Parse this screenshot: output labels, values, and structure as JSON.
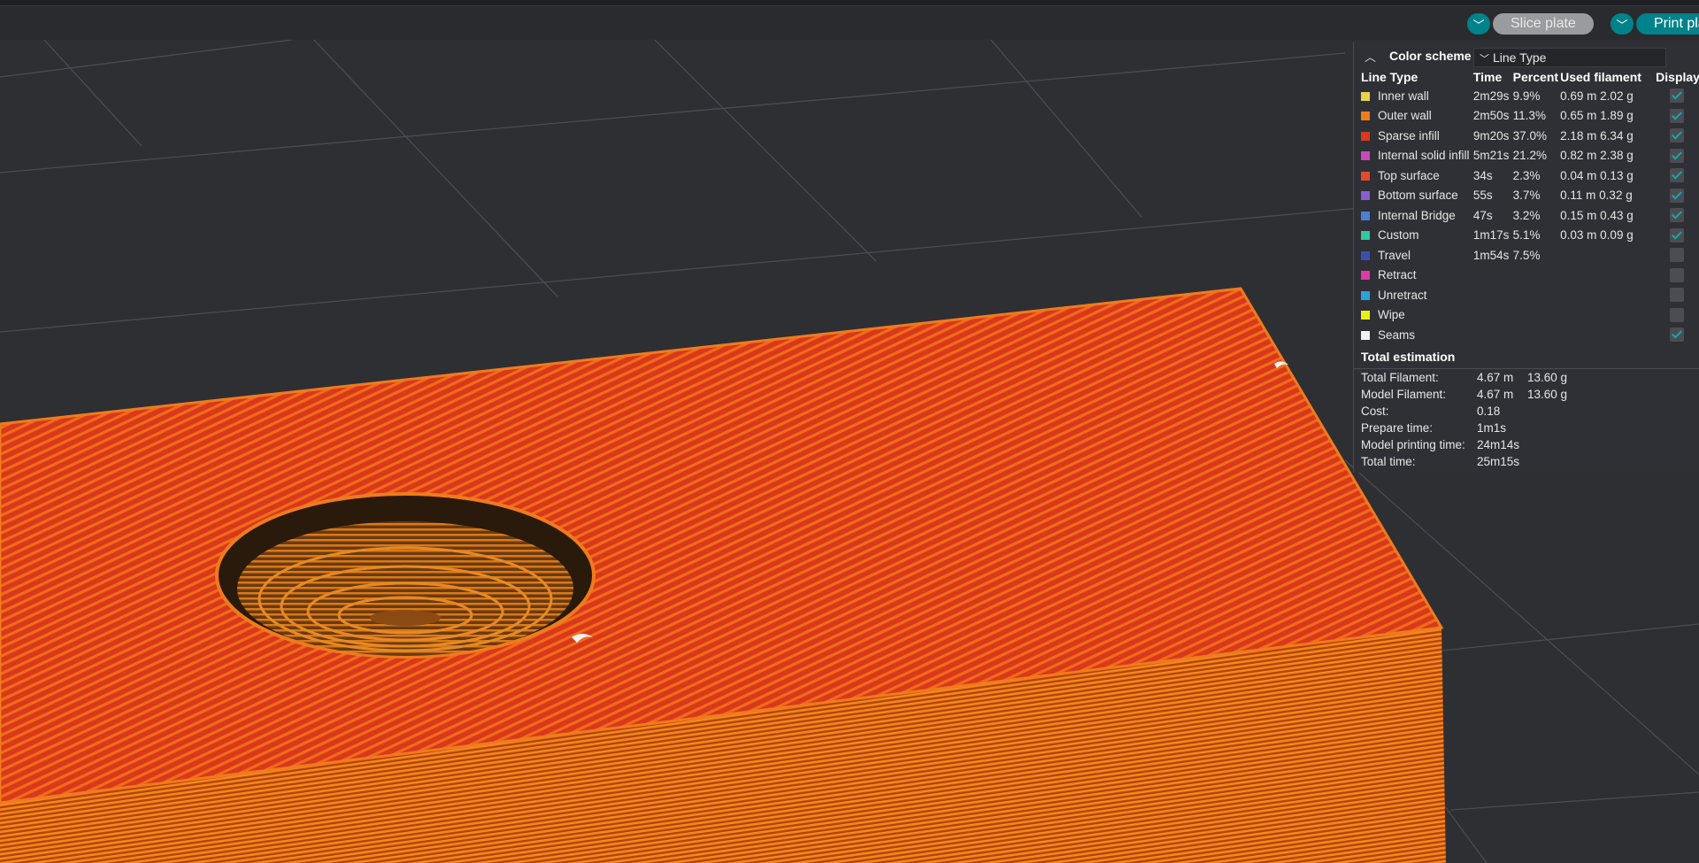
{
  "toolbar": {
    "slice_label": "Slice plate",
    "print_label": "Print plate",
    "dropdown_icon": "chevron-down-icon",
    "accent_color": "#00828a"
  },
  "legend": {
    "collapse_icon": "chevron-up-icon",
    "color_scheme_label": "Color scheme",
    "color_scheme_value": "Line Type",
    "headers": {
      "line_type": "Line Type",
      "time": "Time",
      "percent": "Percent",
      "used_filament": "Used filament",
      "display": "Display"
    },
    "rows": [
      {
        "name": "Inner wall",
        "color": "#e5d44a",
        "time": "2m29s",
        "percent": "9.9%",
        "length": "0.69 m",
        "weight": "2.02 g",
        "display": true
      },
      {
        "name": "Outer wall",
        "color": "#f07b1d",
        "time": "2m50s",
        "percent": "11.3%",
        "length": "0.65 m",
        "weight": "1.89 g",
        "display": true
      },
      {
        "name": "Sparse infill",
        "color": "#d93a1e",
        "time": "9m20s",
        "percent": "37.0%",
        "length": "2.18 m",
        "weight": "6.34 g",
        "display": true
      },
      {
        "name": "Internal solid infill",
        "color": "#c84bb9",
        "time": "5m21s",
        "percent": "21.2%",
        "length": "0.82 m",
        "weight": "2.38 g",
        "display": true
      },
      {
        "name": "Top surface",
        "color": "#e34a2c",
        "time": "34s",
        "percent": "2.3%",
        "length": "0.04 m",
        "weight": "0.13 g",
        "display": true
      },
      {
        "name": "Bottom surface",
        "color": "#8a5cd0",
        "time": "55s",
        "percent": "3.7%",
        "length": "0.11 m",
        "weight": "0.32 g",
        "display": true
      },
      {
        "name": "Internal Bridge",
        "color": "#4a7fd6",
        "time": "47s",
        "percent": "3.2%",
        "length": "0.15 m",
        "weight": "0.43 g",
        "display": true
      },
      {
        "name": "Custom",
        "color": "#2ec9a0",
        "time": "1m17s",
        "percent": "5.1%",
        "length": "0.03 m",
        "weight": "0.09 g",
        "display": true
      },
      {
        "name": "Travel",
        "color": "#3a4fb0",
        "time": "1m54s",
        "percent": "7.5%",
        "length": "",
        "weight": "",
        "display": false
      },
      {
        "name": "Retract",
        "color": "#e03aa8",
        "time": "",
        "percent": "",
        "length": "",
        "weight": "",
        "display": false
      },
      {
        "name": "Unretract",
        "color": "#2aa3e0",
        "time": "",
        "percent": "",
        "length": "",
        "weight": "",
        "display": false
      },
      {
        "name": "Wipe",
        "color": "#e8f01a",
        "time": "",
        "percent": "",
        "length": "",
        "weight": "",
        "display": false
      },
      {
        "name": "Seams",
        "color": "#f2f2f2",
        "time": "",
        "percent": "",
        "length": "",
        "weight": "",
        "display": true
      }
    ],
    "total": {
      "title": "Total estimation",
      "rows": [
        {
          "label": "Total Filament:",
          "v1": "4.67 m",
          "v2": "13.60 g"
        },
        {
          "label": "Model Filament:",
          "v1": "4.67 m",
          "v2": "13.60 g"
        },
        {
          "label": "Cost:",
          "v1": "0.18",
          "v2": ""
        },
        {
          "label": "Prepare time:",
          "v1": "1m1s",
          "v2": ""
        },
        {
          "label": "Model printing time:",
          "v1": "24m14s",
          "v2": ""
        },
        {
          "label": "Total time:",
          "v1": "25m15s",
          "v2": ""
        }
      ]
    }
  }
}
